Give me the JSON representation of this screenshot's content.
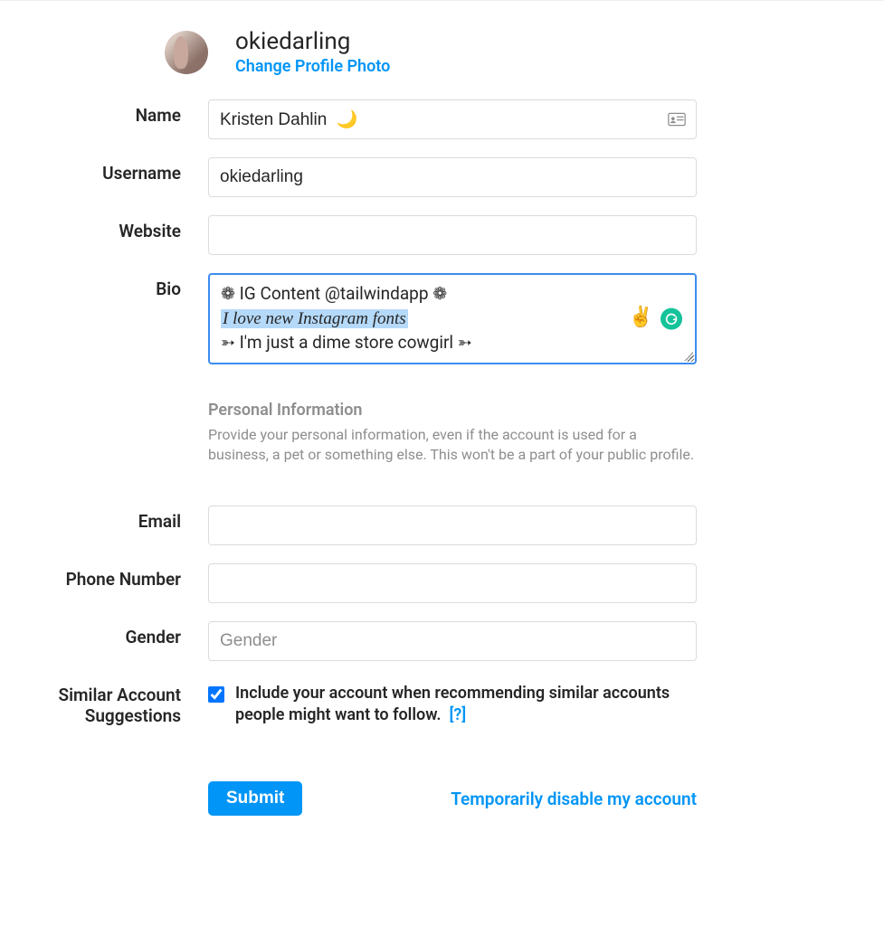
{
  "header": {
    "username": "okiedarling",
    "change_photo_label": "Change Profile Photo"
  },
  "labels": {
    "name": "Name",
    "username": "Username",
    "website": "Website",
    "bio": "Bio",
    "email": "Email",
    "phone": "Phone Number",
    "gender": "Gender",
    "similar": "Similar Account Suggestions"
  },
  "fields": {
    "name_value": "Kristen Dahlin  🌙",
    "username_value": "okiedarling",
    "website_value": "",
    "email_value": "",
    "phone_value": "",
    "gender_placeholder": "Gender",
    "gender_value": ""
  },
  "bio": {
    "line1": "❁ IG Content @tailwindapp ❁",
    "line2": "I love new Instagram fonts",
    "line3_prefix": "➳ I'm just a dime store cowgirl ➳",
    "peace_emoji": "✌️"
  },
  "personal_info": {
    "heading": "Personal Information",
    "text": "Provide your personal information, even if the account is used for a business, a pet or something else. This won't be a part of your public profile."
  },
  "similar": {
    "checkbox_label": "Include your account when recommending similar accounts people might want to follow.",
    "help": "[?]",
    "checked": true
  },
  "actions": {
    "submit": "Submit",
    "disable": "Temporarily disable my account"
  }
}
